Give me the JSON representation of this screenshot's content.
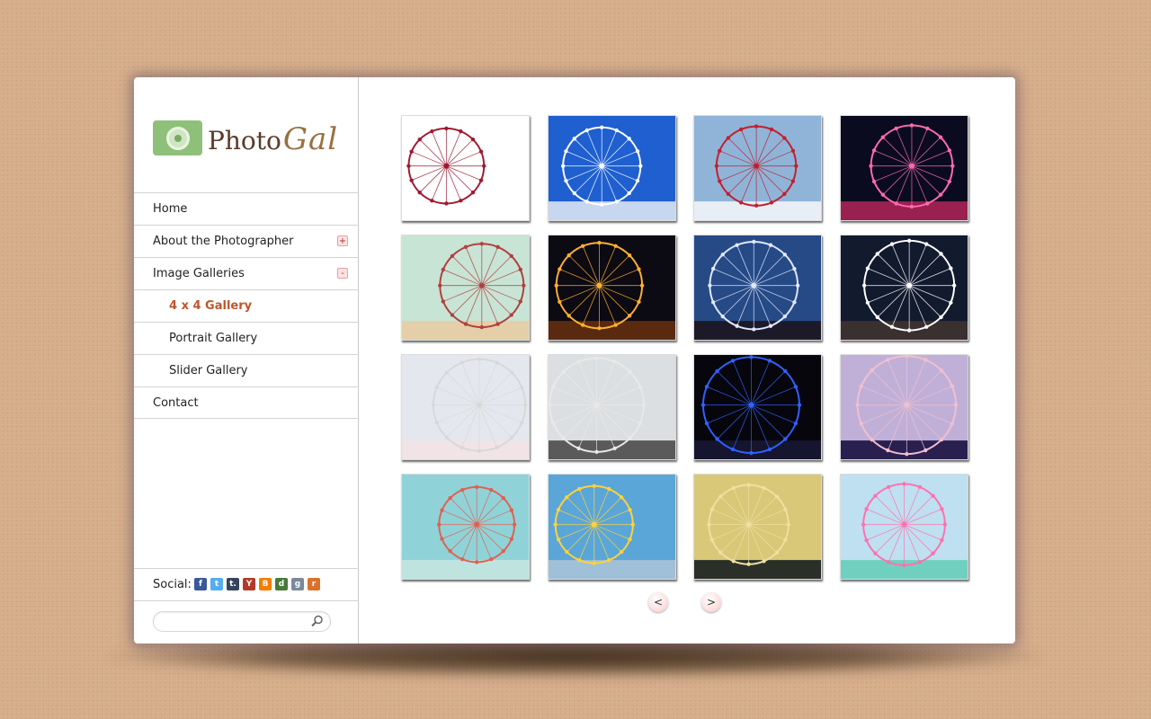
{
  "logo": {
    "word": "Photo",
    "accent": "Gal",
    "camera_color": "#8fc07a"
  },
  "nav": [
    {
      "label": "Home"
    },
    {
      "label": "About the Photographer",
      "toggle": "+"
    },
    {
      "label": "Image Galleries",
      "toggle": "-"
    },
    {
      "label": "4 x 4 Gallery",
      "active": true,
      "sub": true
    },
    {
      "label": "Portrait Gallery",
      "sub": true
    },
    {
      "label": "Slider Gallery",
      "sub": true
    },
    {
      "label": "Contact"
    }
  ],
  "social": {
    "label": "Social:",
    "icons": [
      {
        "name": "facebook-icon",
        "glyph": "f",
        "color": "#3b5998"
      },
      {
        "name": "twitter-icon",
        "glyph": "t",
        "color": "#55acee"
      },
      {
        "name": "tumblr-icon",
        "glyph": "t.",
        "color": "#35465c"
      },
      {
        "name": "yahoo-icon",
        "glyph": "Y",
        "color": "#b33a2a"
      },
      {
        "name": "blogger-icon",
        "glyph": "B",
        "color": "#f57d00"
      },
      {
        "name": "delicious-icon",
        "glyph": "d",
        "color": "#4a7a3a"
      },
      {
        "name": "google-icon",
        "glyph": "g",
        "color": "#7a8a9a"
      },
      {
        "name": "rss-icon",
        "glyph": "r",
        "color": "#d9722b"
      }
    ]
  },
  "search": {
    "placeholder": "",
    "value": ""
  },
  "gallery": {
    "columns": 4,
    "thumbs": [
      {
        "name": "ferris-wheel-colorful-gondolas",
        "sky": "#ffffff",
        "ground": "#ffffff",
        "wheel": "#a01830"
      },
      {
        "name": "ferris-wheel-blue-sky",
        "sky": "#1f5fd0",
        "ground": "#c7d7f0",
        "wheel": "#ffffff"
      },
      {
        "name": "gondola-red-white",
        "sky": "#8fb4d8",
        "ground": "#e8eef5",
        "wheel": "#c02030"
      },
      {
        "name": "fairground-night-lights",
        "sky": "#0b0b20",
        "ground": "#9a2050",
        "wheel": "#ff6ab0"
      },
      {
        "name": "vintage-wheel-pastel",
        "sky": "#c8e4d4",
        "ground": "#e4cfa8",
        "wheel": "#b04040"
      },
      {
        "name": "night-wheel-reflection",
        "sky": "#0c0a12",
        "ground": "#5a2a10",
        "wheel": "#ffb030"
      },
      {
        "name": "dusk-wheel-blue",
        "sky": "#264a86",
        "ground": "#1c1a28",
        "wheel": "#e0e8ff"
      },
      {
        "name": "white-wheel-night",
        "sky": "#121a2e",
        "ground": "#3a3030",
        "wheel": "#ffffff"
      },
      {
        "name": "pale-wheel-rollercoaster",
        "sky": "#e4e8ee",
        "ground": "#f0e4e6",
        "wheel": "#d8d8d8"
      },
      {
        "name": "wheel-grey-sky-plaza",
        "sky": "#dcdfe2",
        "ground": "#5a5a5a",
        "wheel": "#e8e8e8"
      },
      {
        "name": "london-eye-blue-night",
        "sky": "#06060c",
        "ground": "#151530",
        "wheel": "#3060ff"
      },
      {
        "name": "purple-wheel-trees",
        "sky": "#c0b0d8",
        "ground": "#2a2050",
        "wheel": "#f0c0d0"
      },
      {
        "name": "coral-wheel-aqua",
        "sky": "#8fd3d8",
        "ground": "#bfe4e0",
        "wheel": "#e06050"
      },
      {
        "name": "pier-wheel-yellow-coaster",
        "sky": "#5aa6d8",
        "ground": "#a0c0d8",
        "wheel": "#ffd23a"
      },
      {
        "name": "golden-wheel-city",
        "sky": "#d8c878",
        "ground": "#2a3028",
        "wheel": "#f0e0a0"
      },
      {
        "name": "fairground-pastel-rides",
        "sky": "#bfe0f0",
        "ground": "#70d0c0",
        "wheel": "#ff70b0"
      }
    ]
  },
  "pager": {
    "prev": "<",
    "next": ">"
  }
}
